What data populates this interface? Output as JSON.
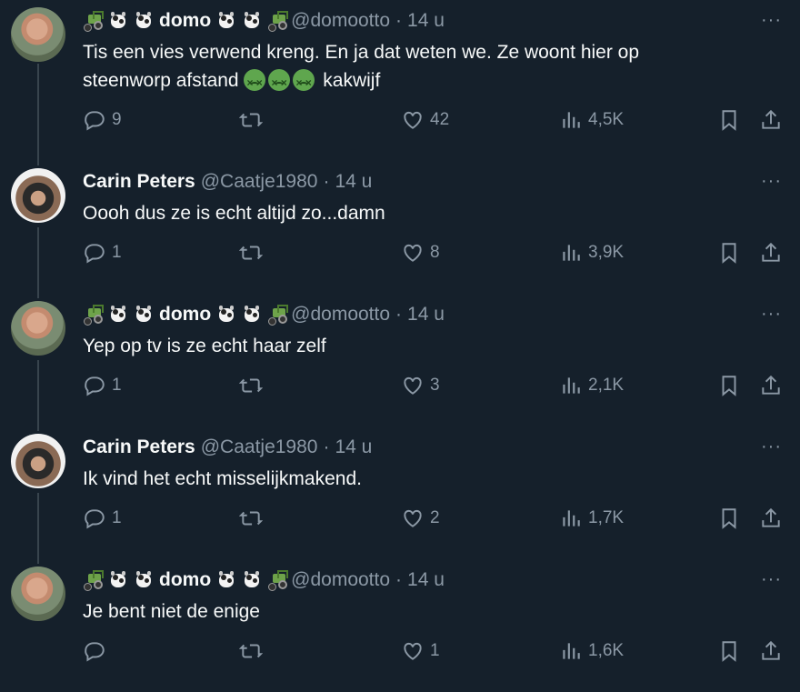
{
  "theme": {
    "background": "#15202b",
    "text": "#f7f9f9",
    "muted": "#8b98a5"
  },
  "tweets": [
    {
      "author": "domo",
      "handle": "@domootto",
      "time": "14 u",
      "text_before": "Tis een vies verwend kreng. En ja dat weten we. Ze woont hier op steenworp afstand",
      "text_after": "kakwijf",
      "replies": "9",
      "likes": "42",
      "views": "4,5K"
    },
    {
      "author": "Carin Peters",
      "handle": "@Caatje1980",
      "time": "14 u",
      "text": "Oooh dus ze is echt altijd zo...damn",
      "replies": "1",
      "likes": "8",
      "views": "3,9K"
    },
    {
      "author": "domo",
      "handle": "@domootto",
      "time": "14 u",
      "text": "Yep op tv is ze echt haar zelf",
      "replies": "1",
      "likes": "3",
      "views": "2,1K"
    },
    {
      "author": "Carin Peters",
      "handle": "@Caatje1980",
      "time": "14 u",
      "text": "Ik vind het echt misselijkmakend.",
      "replies": "1",
      "likes": "2",
      "views": "1,7K"
    },
    {
      "author": "domo",
      "handle": "@domootto",
      "time": "14 u",
      "text": "Je bent niet de enige",
      "replies": "",
      "likes": "1",
      "views": "1,6K"
    }
  ],
  "dot": "·",
  "more": "···",
  "icons": [
    "reply-icon",
    "retweet-icon",
    "like-icon",
    "views-icon",
    "bookmark-icon",
    "share-icon",
    "tractor-emoji",
    "cow-emoji",
    "sick-face-emoji",
    "more-icon"
  ]
}
